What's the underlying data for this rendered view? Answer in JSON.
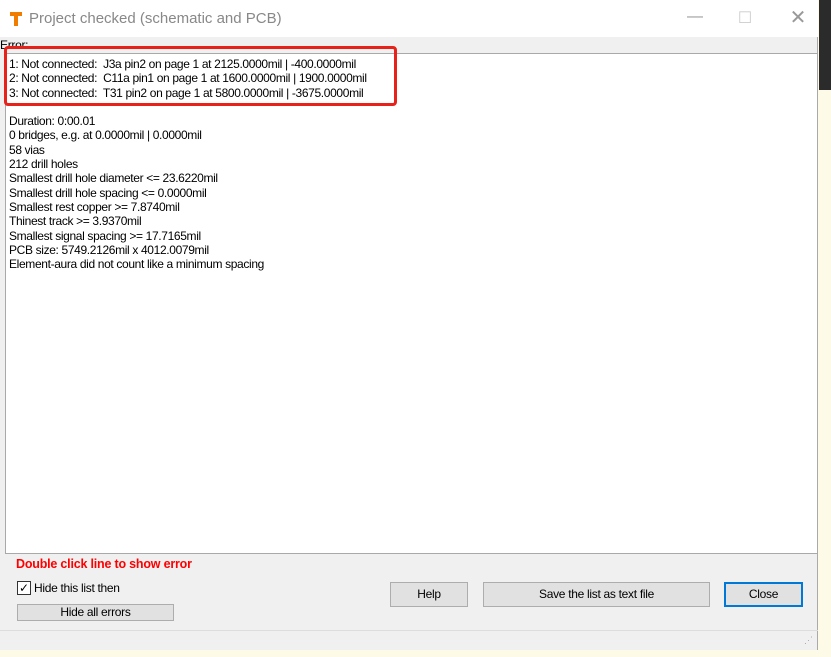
{
  "window": {
    "title": "Project checked (schematic and PCB)",
    "minimize": "—",
    "maximize": "☐",
    "close": "✕"
  },
  "list_label": "Error:",
  "errors": [
    "1: Not connected:  J3a pin2 on page 1 at 2125.0000mil | -400.0000mil",
    "2: Not connected:  C11a pin1 on page 1 at 1600.0000mil | 1900.0000mil",
    "3: Not connected:  T31 pin2 on page 1 at 5800.0000mil | -3675.0000mil"
  ],
  "summary": [
    "Duration: 0:00.01",
    "0 bridges, e.g. at 0.0000mil | 0.0000mil",
    "58 vias",
    "212 drill holes",
    "Smallest drill hole diameter <= 23.6220mil",
    "Smallest drill hole spacing <= 0.0000mil",
    "Smallest rest copper >= 7.8740mil",
    "Thinest track >= 3.9370mil",
    "Smallest signal spacing >= 17.7165mil",
    "PCB size: 5749.2126mil x 4012.0079mil",
    "Element-aura did not count like a minimum spacing"
  ],
  "hint": "Double click line to show error",
  "hide_list": {
    "label": "Hide this list then",
    "checked": true,
    "mark": "✓"
  },
  "buttons": {
    "hide_all": "Hide all errors",
    "help": "Help",
    "save": "Save the list as text file",
    "close": "Close"
  },
  "colors": {
    "hint": "#ff0000",
    "highlight": "#e8211a",
    "focus": "#0078d7",
    "icon": "#f07d00"
  }
}
